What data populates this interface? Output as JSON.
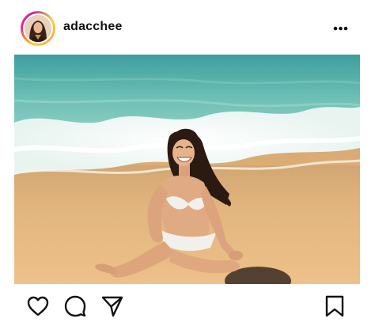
{
  "post": {
    "username": "adacchee",
    "avatar": {
      "icon": "profile-photo"
    },
    "more_icon": "more-horizontal-icon",
    "image": {
      "subject": "woman-in-white-bikini-sitting-in-shallow-surf-on-sandy-beach"
    },
    "actions": {
      "like_icon": "heart-icon",
      "comment_icon": "comment-bubble-icon",
      "share_icon": "paper-plane-icon",
      "save_icon": "bookmark-icon"
    }
  },
  "colors": {
    "text": "#111111",
    "sea": "#5fb3b0",
    "sand": "#e2b67c",
    "story_ring": "#ee2a7b"
  }
}
